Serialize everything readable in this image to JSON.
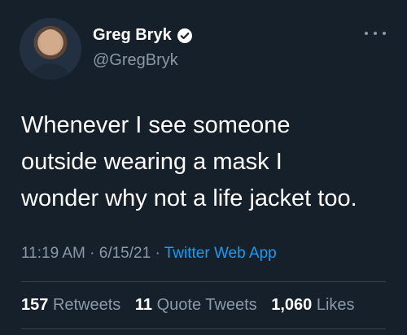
{
  "author": {
    "name": "Greg Bryk",
    "handle": "@GregBryk",
    "verified": true
  },
  "tweet": {
    "lines": [
      "Whenever I see someone",
      "outside wearing a mask I",
      "wonder why not a life jacket too."
    ],
    "time": "11:19 AM",
    "separator": "·",
    "date": "6/15/21",
    "source": "Twitter Web App"
  },
  "stats": {
    "retweets_count": "157",
    "retweets_label": "Retweets",
    "quotes_count": "11",
    "quotes_label": "Quote Tweets",
    "likes_count": "1,060",
    "likes_label": "Likes"
  },
  "colors": {
    "background": "#15202b",
    "text": "#ffffff",
    "muted": "#8b98a5",
    "accent": "#1d9bf0"
  },
  "icons": {
    "verified": "verified-badge-icon",
    "more": "more-horizontal-icon"
  }
}
